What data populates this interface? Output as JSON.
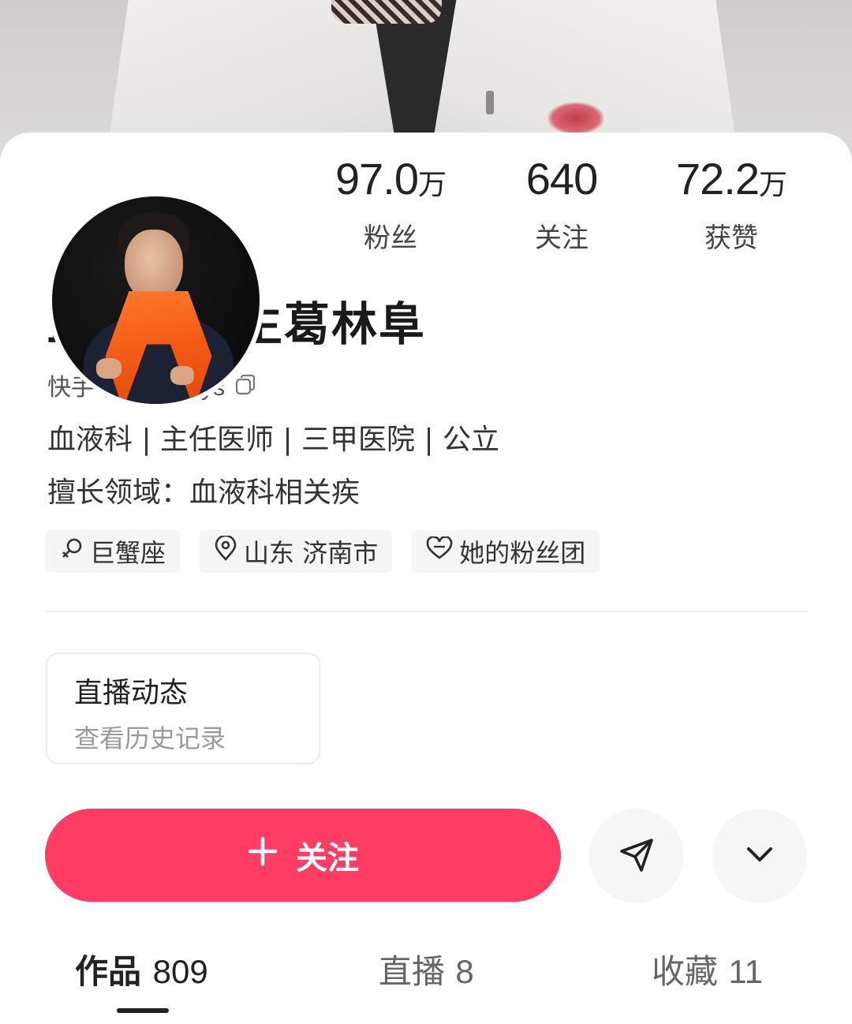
{
  "profile": {
    "name": "血液病医生葛林阜",
    "kuaishou_id_label": "快手号: gelinfuys",
    "bio_line1": "血液科 | 主任医师 | 三甲医院 | 公立",
    "bio_line2": "擅长领域：血液科相关疾"
  },
  "stats": {
    "fans": {
      "value": "97.0",
      "unit": "万",
      "label": "粉丝"
    },
    "following": {
      "value": "640",
      "unit": "",
      "label": "关注"
    },
    "likes": {
      "value": "72.2",
      "unit": "万",
      "label": "获赞"
    }
  },
  "tags": [
    {
      "icon": "female-icon",
      "label": "巨蟹座"
    },
    {
      "icon": "location-pin-icon",
      "label": "山东 济南市"
    },
    {
      "icon": "heart-icon",
      "label": "她的粉丝团"
    }
  ],
  "live_card": {
    "title": "直播动态",
    "subtitle": "查看历史记录"
  },
  "actions": {
    "follow_label": "关注",
    "share_icon": "send-icon",
    "more_icon": "chevron-down-icon"
  },
  "tabs": [
    {
      "label": "作品",
      "count": "809",
      "active": true
    },
    {
      "label": "直播",
      "count": "8",
      "active": false
    },
    {
      "label": "收藏",
      "count": "11",
      "active": false
    }
  ],
  "colors": {
    "accent": "#ff3c64",
    "tag_bg": "#f5f5f5",
    "muted_text": "#9a9a9a"
  }
}
